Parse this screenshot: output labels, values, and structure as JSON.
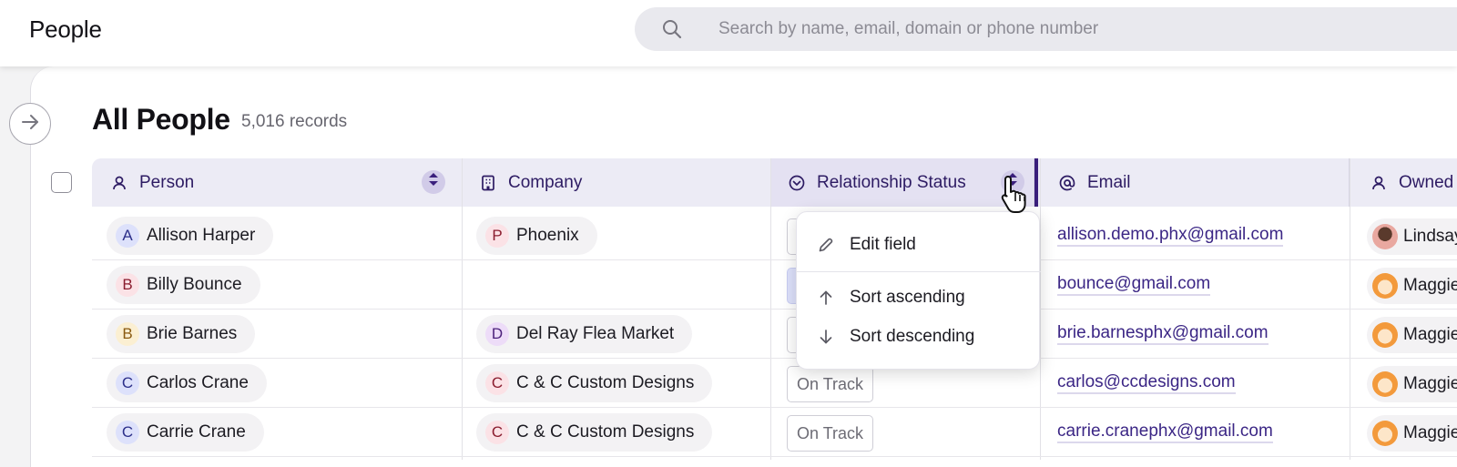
{
  "app": {
    "title": "People"
  },
  "search": {
    "placeholder": "Search by name, email, domain or phone number",
    "icon": "search-icon"
  },
  "view": {
    "title": "All People",
    "record_count": "5,016 records"
  },
  "columns": [
    {
      "label": "Person",
      "icon": "person-icon"
    },
    {
      "label": "Company",
      "icon": "building-icon"
    },
    {
      "label": "Relationship Status",
      "icon": "chevron-circle-icon"
    },
    {
      "label": "Email",
      "icon": "at-sign-icon"
    },
    {
      "label": "Owned",
      "icon": "person-icon"
    }
  ],
  "rows": [
    {
      "person": "Allison Harper",
      "person_initial": "A",
      "company": "Phoenix",
      "company_initial": "P",
      "status": "",
      "email": "allison.demo.phx@gmail.com",
      "owner": "Lindsay"
    },
    {
      "person": "Billy Bounce",
      "person_initial": "B",
      "company": "",
      "company_initial": "",
      "status": "",
      "email": "bounce@gmail.com",
      "owner": "Maggie"
    },
    {
      "person": "Brie Barnes",
      "person_initial": "B",
      "company": "Del Ray Flea Market",
      "company_initial": "D",
      "status": "",
      "email": "brie.barnesphx@gmail.com",
      "owner": "Maggie"
    },
    {
      "person": "Carlos Crane",
      "person_initial": "C",
      "company": "C & C Custom Designs",
      "company_initial": "C",
      "status": "On Track",
      "email": "carlos@ccdesigns.com",
      "owner": "Maggie"
    },
    {
      "person": "Carrie Crane",
      "person_initial": "C",
      "company": "C & C Custom Designs",
      "company_initial": "C",
      "status": "On Track",
      "email": "carrie.cranephx@gmail.com",
      "owner": "Maggie"
    }
  ],
  "menu": {
    "edit": "Edit field",
    "sort_asc": "Sort ascending",
    "sort_desc": "Sort descending"
  },
  "colors": {
    "accent": "#3a1f7c",
    "header_bg": "#ecebf5",
    "link": "#3b2685"
  }
}
